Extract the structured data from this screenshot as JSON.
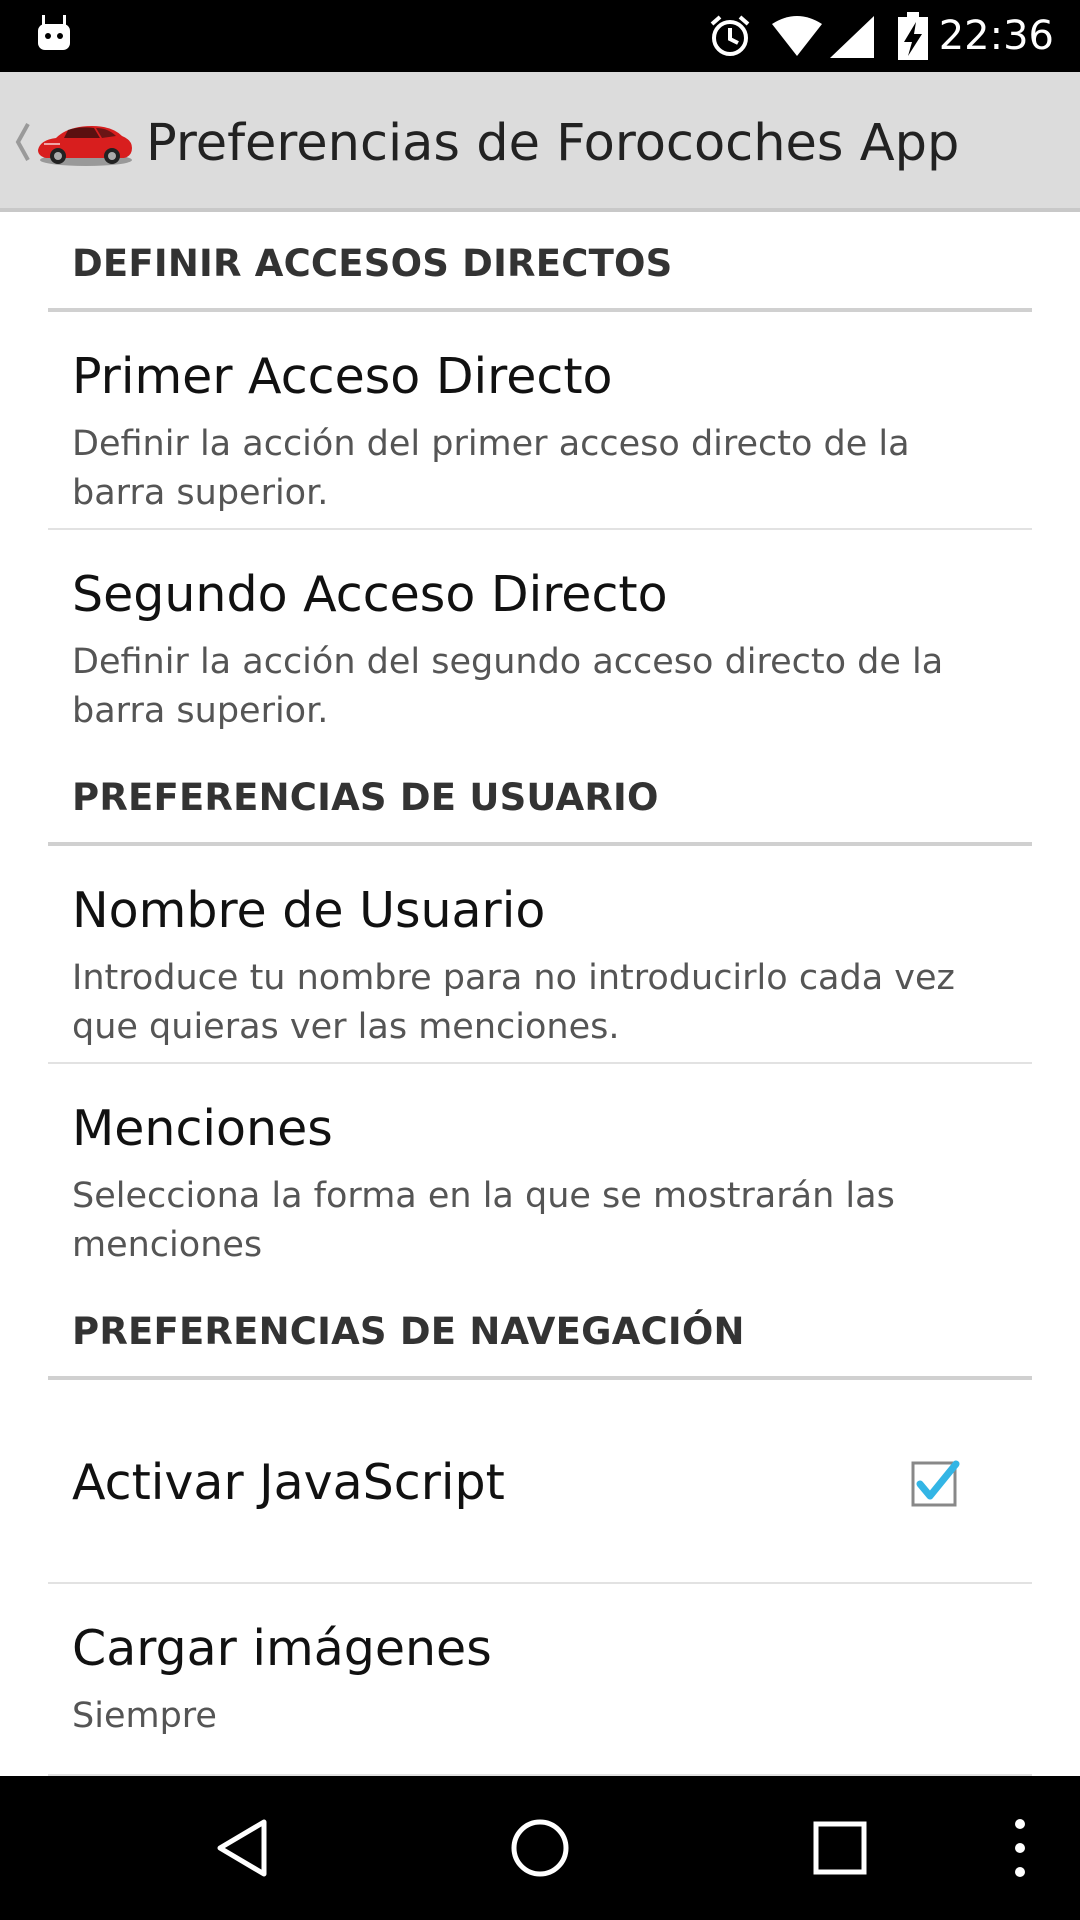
{
  "status_bar": {
    "time": "22:36",
    "icons": [
      "android-notification-icon",
      "alarm-icon",
      "wifi-icon",
      "signal-icon",
      "battery-charging-icon"
    ]
  },
  "action_bar": {
    "title": "Preferencias de Forocoches App",
    "logo": "red-car-logo",
    "back_icon": "chevron-left-icon"
  },
  "sections": [
    {
      "header": "DEFINIR ACCESOS DIRECTOS",
      "items": [
        {
          "title": "Primer Acceso Directo",
          "summary": "Definir la acción del primer acceso directo de la barra superior."
        },
        {
          "title": "Segundo Acceso Directo",
          "summary": "Definir la acción del segundo acceso directo de la barra superior."
        }
      ]
    },
    {
      "header": "PREFERENCIAS DE USUARIO",
      "items": [
        {
          "title": "Nombre de Usuario",
          "summary": "Introduce tu nombre para no introducirlo cada vez que quieras ver las menciones."
        },
        {
          "title": "Menciones",
          "summary": "Selecciona la forma en la que se mostrarán las menciones"
        }
      ]
    },
    {
      "header": "PREFERENCIAS DE NAVEGACIÓN",
      "items": [
        {
          "title": "Activar JavaScript",
          "checked": true
        },
        {
          "title": "Cargar imágenes",
          "summary": "Siempre"
        }
      ]
    }
  ],
  "nav_bar": {
    "buttons": [
      "back-icon",
      "home-icon",
      "recents-icon",
      "overflow-menu-icon"
    ]
  },
  "colors": {
    "action_bar_bg": "#dcdcdc",
    "checkbox_check": "#33b5e5",
    "content_bg": "#ffffff"
  }
}
